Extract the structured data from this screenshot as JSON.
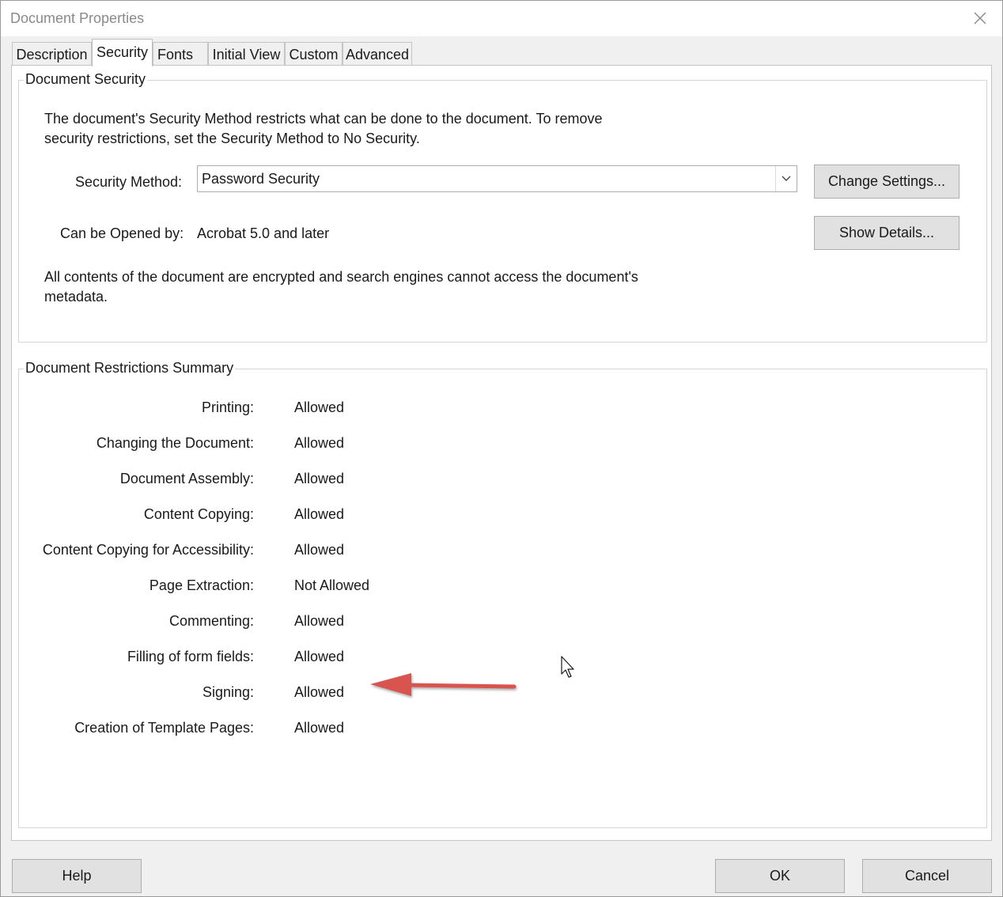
{
  "window": {
    "title": "Document Properties"
  },
  "tabs": [
    {
      "label": "Description"
    },
    {
      "label": "Security"
    },
    {
      "label": "Fonts"
    },
    {
      "label": "Initial View"
    },
    {
      "label": "Custom"
    },
    {
      "label": "Advanced"
    }
  ],
  "active_tab": "Security",
  "document_security": {
    "legend": "Document Security",
    "intro_line1": "The document's Security Method restricts what can be done to the document. To remove",
    "intro_line2": "security restrictions, set the Security Method to No Security.",
    "security_method_label": "Security Method:",
    "security_method_value": "Password Security",
    "change_settings_label": "Change Settings...",
    "opened_by_label": "Can be Opened by:",
    "opened_by_value": "Acrobat 5.0 and later",
    "show_details_label": "Show Details...",
    "encryption_note_line1": "All contents of the document are encrypted and search engines cannot access the document's",
    "encryption_note_line2": "metadata."
  },
  "restrictions": {
    "legend": "Document Restrictions Summary",
    "rows": [
      {
        "label": "Printing:",
        "value": "Allowed"
      },
      {
        "label": "Changing the Document:",
        "value": "Allowed"
      },
      {
        "label": "Document Assembly:",
        "value": "Allowed"
      },
      {
        "label": "Content Copying:",
        "value": "Allowed"
      },
      {
        "label": "Content Copying for Accessibility:",
        "value": "Allowed"
      },
      {
        "label": "Page Extraction:",
        "value": "Not Allowed"
      },
      {
        "label": "Commenting:",
        "value": "Allowed"
      },
      {
        "label": "Filling of form fields:",
        "value": "Allowed"
      },
      {
        "label": "Signing:",
        "value": "Allowed"
      },
      {
        "label": "Creation of Template Pages:",
        "value": "Allowed"
      }
    ]
  },
  "footer": {
    "help_label": "Help",
    "ok_label": "OK",
    "cancel_label": "Cancel"
  },
  "colors": {
    "annotation_arrow": "#d9534f",
    "button_face": "#e1e1e1",
    "dialog_background": "#f0f0f0"
  },
  "icons": {
    "close": "close-icon",
    "dropdown": "chevron-down-icon",
    "annotation": "arrow-left-annotation-icon",
    "cursor": "mouse-pointer-icon"
  }
}
